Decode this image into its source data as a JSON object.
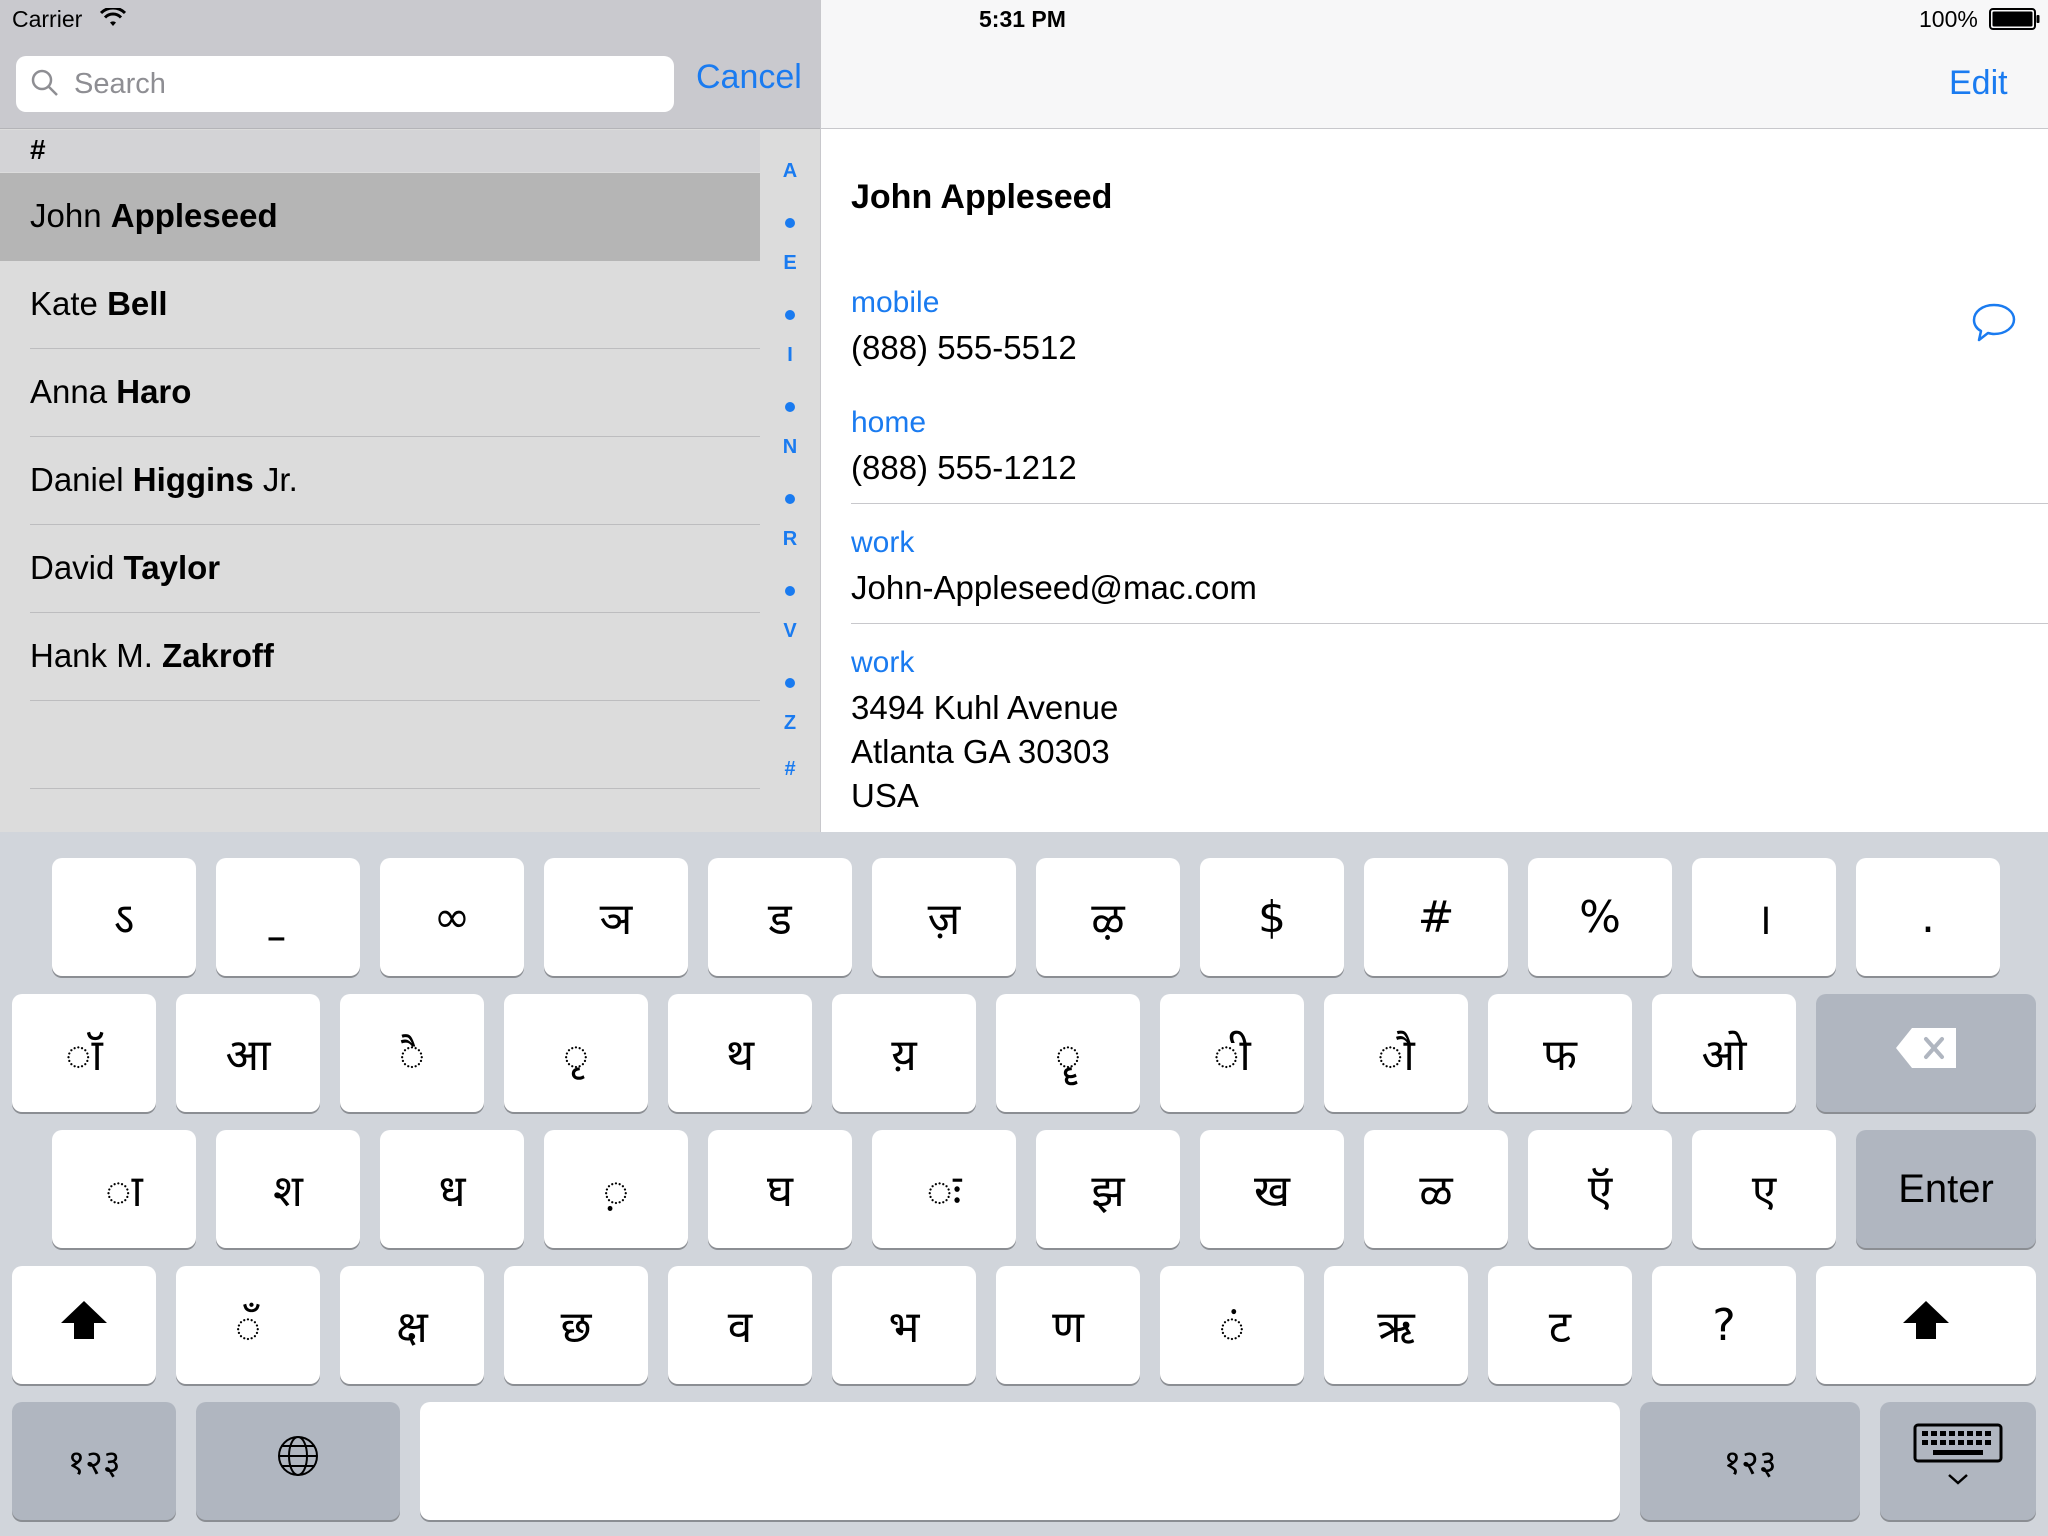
{
  "status": {
    "carrier": "Carrier",
    "time": "5:31 PM",
    "battery": "100%"
  },
  "search": {
    "placeholder": "Search",
    "cancel_label": "Cancel"
  },
  "list": {
    "section": "#",
    "contacts": [
      {
        "first": "John",
        "last": "Appleseed",
        "suffix": "",
        "selected": true
      },
      {
        "first": "Kate",
        "last": "Bell",
        "suffix": "",
        "selected": false
      },
      {
        "first": "Anna",
        "last": "Haro",
        "suffix": "",
        "selected": false
      },
      {
        "first": "Daniel",
        "last": "Higgins",
        "suffix": "Jr.",
        "selected": false
      },
      {
        "first": "David",
        "last": "Taylor",
        "suffix": "",
        "selected": false
      },
      {
        "first": "Hank M.",
        "last": "Zakroff",
        "suffix": "",
        "selected": false
      }
    ],
    "index": [
      "A",
      "•",
      "E",
      "•",
      "I",
      "•",
      "N",
      "•",
      "R",
      "•",
      "V",
      "•",
      "Z",
      "#"
    ]
  },
  "detail": {
    "edit_label": "Edit",
    "name": "John Appleseed",
    "fields": [
      {
        "label": "mobile",
        "value": "(888) 555-5512"
      },
      {
        "label": "home",
        "value": "(888) 555-1212"
      },
      {
        "label": "work",
        "value": "John-Appleseed@mac.com"
      },
      {
        "label": "work",
        "value": "3494 Kuhl Avenue\nAtlanta GA 30303\nUSA"
      }
    ],
    "message_icon": "message-bubble-icon"
  },
  "keyboard": {
    "rows": [
      [
        "ऽ",
        "॒",
        "∞",
        "ञ",
        "ड",
        "ज़",
        "ऴ",
        "$",
        "#",
        "%",
        "।",
        "."
      ],
      [
        "ॉ",
        "आ",
        "ै",
        "ृ",
        "थ",
        "य़",
        "ॄ",
        "ी",
        "ौ",
        "फ",
        "ओ",
        "delete"
      ],
      [
        "ा",
        "श",
        "ध",
        "़",
        "घ",
        "ः",
        "झ",
        "ख",
        "ळ",
        "ऍ",
        "ए",
        "Enter"
      ],
      [
        "shift",
        "ँ",
        "क्ष",
        "छ",
        "व",
        "भ",
        "ण",
        "ं",
        "ऋ",
        "ट",
        "?",
        "shift"
      ]
    ],
    "numbers_label": "१२३",
    "globe_icon": "globe-icon",
    "dismiss_icon": "keyboard-dismiss-icon",
    "shift_icon": "shift-arrow-icon",
    "delete_icon": "delete-backspace-icon"
  },
  "colors": {
    "accent": "#1a7bf0",
    "keyboard_bg": "#d1d5db",
    "list_bg": "#dcdcdc",
    "selected_row": "#b5b5b5"
  }
}
